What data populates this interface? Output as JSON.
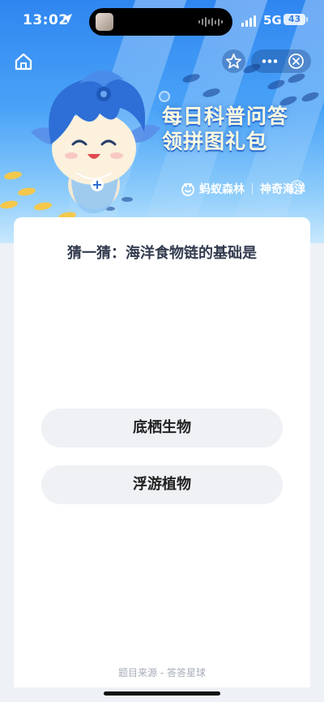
{
  "status_bar": {
    "time": "13:02",
    "network": "5G",
    "battery": "43"
  },
  "banner": {
    "title_line1": "每日科普问答",
    "title_line2": "领拼图礼包",
    "brand_left": "蚂蚁森林",
    "brand_right": "神奇海洋"
  },
  "quiz": {
    "question": "猜一猜：海洋食物链的基础是",
    "options": [
      {
        "label": "底栖生物"
      },
      {
        "label": "浮游植物"
      }
    ],
    "source": "题目来源 - 答答星球"
  },
  "colors": {
    "banner_top": "#2f86f0",
    "title_text": "#fffbe0",
    "option_bg": "#eff1f5",
    "question_text": "#333b4f"
  },
  "icons": {
    "home": "home-icon",
    "favorite": "star-icon",
    "more": "more-dots-icon",
    "close": "close-icon",
    "location": "location-arrow-icon",
    "brand": "ant-forest-icon"
  }
}
